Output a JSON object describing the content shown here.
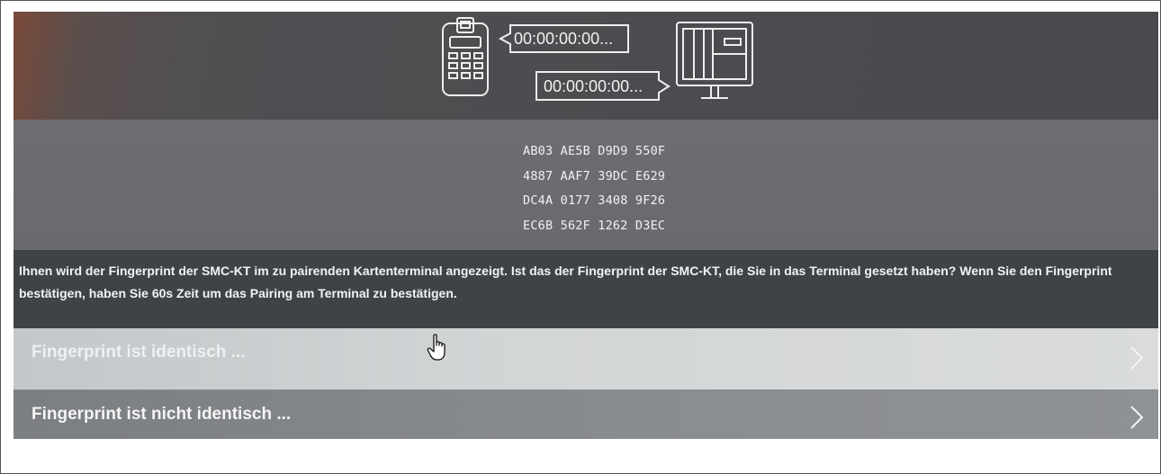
{
  "illustration": {
    "time_top": "00:00:00:00...",
    "time_bottom": "00:00:00:00...",
    "icons": [
      "card-terminal-icon",
      "monitor-icon"
    ]
  },
  "fingerprint": {
    "lines": [
      "AB03 AE5B D9D9 550F",
      "4887 AAF7 39DC E629",
      "DC4A 0177 3408 9F26",
      "EC6B 562F 1262 D3EC"
    ]
  },
  "description": "Ihnen wird der Fingerprint der SMC-KT im zu pairenden Kartenterminal angezeigt. Ist das der Fingerprint der SMC-KT, die Sie in das Terminal gesetzt haben? Wenn Sie den Fingerprint bestätigen, haben Sie 60s Zeit um das Pairing am Terminal zu bestätigen.",
  "options": [
    {
      "label": "Fingerprint ist identisch ...",
      "icon": "chevron-right-icon"
    },
    {
      "label": "Fingerprint ist nicht identisch ...",
      "icon": "chevron-right-icon"
    }
  ],
  "cursor": {
    "icon": "hand-pointer-icon"
  }
}
